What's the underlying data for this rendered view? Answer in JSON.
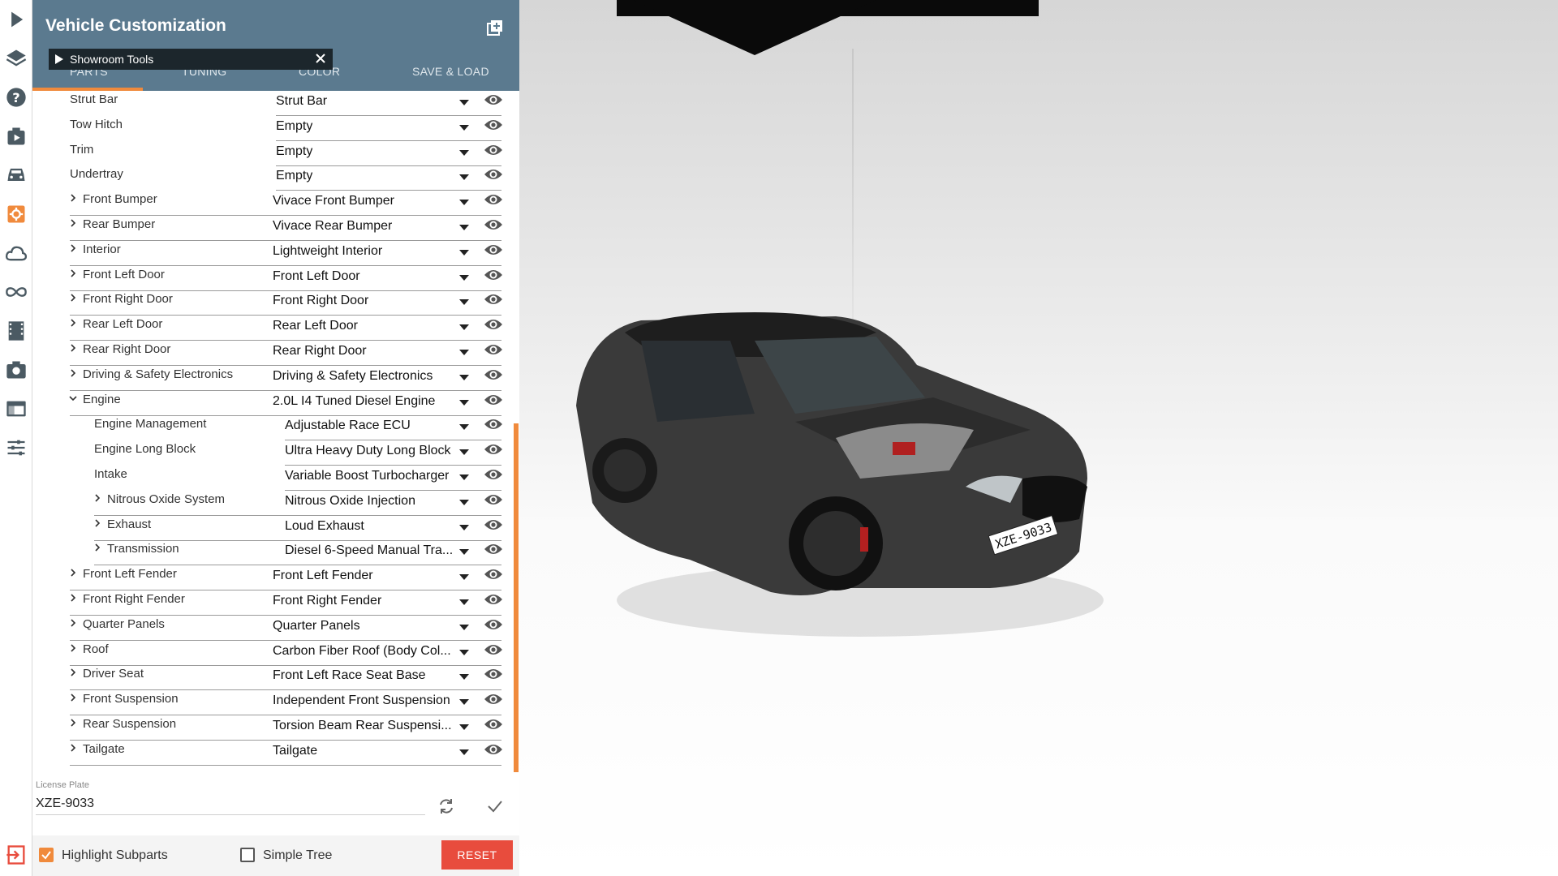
{
  "panel": {
    "title": "Vehicle Customization",
    "tabs": [
      "PARTS",
      "TUNING",
      "COLOR",
      "SAVE & LOAD"
    ],
    "active_tab": "PARTS",
    "showroom_tools": "Showroom Tools"
  },
  "parts": [
    {
      "label": "Strut Bar",
      "value": "Strut Bar",
      "level": 0,
      "expander": "none"
    },
    {
      "label": "Tow Hitch",
      "value": "Empty",
      "level": 0,
      "expander": "none"
    },
    {
      "label": "Trim",
      "value": "Empty",
      "level": 0,
      "expander": "none"
    },
    {
      "label": "Undertray",
      "value": "Empty",
      "level": 0,
      "expander": "none"
    },
    {
      "label": "Front Bumper",
      "value": "Vivace Front Bumper",
      "level": 0,
      "expander": "collapsed"
    },
    {
      "label": "Rear Bumper",
      "value": "Vivace Rear Bumper",
      "level": 0,
      "expander": "collapsed"
    },
    {
      "label": "Interior",
      "value": "Lightweight Interior",
      "level": 0,
      "expander": "collapsed"
    },
    {
      "label": "Front Left Door",
      "value": "Front Left Door",
      "level": 0,
      "expander": "collapsed"
    },
    {
      "label": "Front Right Door",
      "value": "Front Right Door",
      "level": 0,
      "expander": "collapsed"
    },
    {
      "label": "Rear Left Door",
      "value": "Rear Left Door",
      "level": 0,
      "expander": "collapsed"
    },
    {
      "label": "Rear Right Door",
      "value": "Rear Right Door",
      "level": 0,
      "expander": "collapsed"
    },
    {
      "label": "Driving & Safety Electronics",
      "value": "Driving & Safety Electronics",
      "level": 0,
      "expander": "collapsed"
    },
    {
      "label": "Engine",
      "value": "2.0L I4 Tuned Diesel Engine",
      "level": 0,
      "expander": "expanded"
    },
    {
      "label": "Engine Management",
      "value": "Adjustable Race ECU",
      "level": 1,
      "expander": "none"
    },
    {
      "label": "Engine Long Block",
      "value": "Ultra Heavy Duty Long Block",
      "level": 1,
      "expander": "none"
    },
    {
      "label": "Intake",
      "value": "Variable Boost Turbocharger",
      "level": 1,
      "expander": "none"
    },
    {
      "label": "Nitrous Oxide System",
      "value": "Nitrous Oxide Injection",
      "level": 1,
      "expander": "collapsed"
    },
    {
      "label": "Exhaust",
      "value": "Loud Exhaust",
      "level": 1,
      "expander": "collapsed"
    },
    {
      "label": "Transmission",
      "value": "Diesel 6-Speed Manual Tra...",
      "level": 1,
      "expander": "collapsed"
    },
    {
      "label": "Front Left Fender",
      "value": "Front Left Fender",
      "level": 0,
      "expander": "collapsed"
    },
    {
      "label": "Front Right Fender",
      "value": "Front Right Fender",
      "level": 0,
      "expander": "collapsed"
    },
    {
      "label": "Quarter Panels",
      "value": "Quarter Panels",
      "level": 0,
      "expander": "collapsed"
    },
    {
      "label": "Roof",
      "value": "Carbon Fiber Roof (Body Col...",
      "level": 0,
      "expander": "collapsed"
    },
    {
      "label": "Driver Seat",
      "value": "Front Left Race Seat Base",
      "level": 0,
      "expander": "collapsed"
    },
    {
      "label": "Front Suspension",
      "value": "Independent Front Suspension",
      "level": 0,
      "expander": "collapsed"
    },
    {
      "label": "Rear Suspension",
      "value": "Torsion Beam Rear Suspensi...",
      "level": 0,
      "expander": "collapsed"
    },
    {
      "label": "Tailgate",
      "value": "Tailgate",
      "level": 0,
      "expander": "collapsed"
    }
  ],
  "license_plate": {
    "label": "License Plate",
    "value": "XZE-9033"
  },
  "car_plate_text": "XZE-9033",
  "footer": {
    "highlight_subparts": "Highlight Subparts",
    "highlight_checked": true,
    "simple_tree": "Simple Tree",
    "simple_tree_checked": false,
    "reset": "RESET"
  },
  "rail_icons": [
    "play-icon",
    "layers-icon",
    "help-icon",
    "mission-icon",
    "vehicle-icon",
    "parts-icon",
    "cloud-icon",
    "infinity-icon",
    "film-icon",
    "camera-icon",
    "window-icon",
    "sliders-icon",
    "exit-icon"
  ],
  "colors": {
    "header": "#5b7a8f",
    "accent": "#f08a3c",
    "reset": "#e84c3d"
  }
}
